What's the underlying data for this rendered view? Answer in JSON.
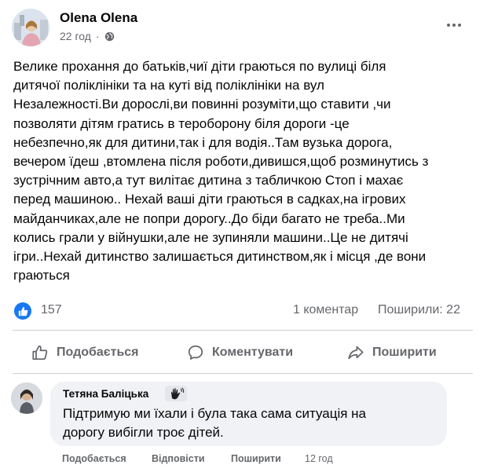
{
  "post": {
    "author": "Olena Olena",
    "time": "22 год",
    "privacy_icon": "globe-icon",
    "text_lines": [
      "Велике прохання до батьків,чиї діти граються по вулиці біля",
      "дитячої поліклініки та на куті від поліклініки на вул",
      "Незалежності.Ви дорослі,ви повинні розуміти,що ставити ,чи",
      "позволяти дітям гратись в тероборону біля дороги -це",
      "небезпечно,як для дитини,так і для водія..Там вузька дорога,",
      "вечером їдеш ,втомлена після роботи,дивишся,щоб розминутись з",
      "зустрічним авто,а тут вилітає дитина з табличкою Стоп і махає",
      "перед машиною.. Нехай ваші діти граються в садках,на ігрових",
      "майданчиках,але не попри дорогу..До біди багато не треба..Ми",
      "колись грали у війнушки,але не зупиняли машини..Це не дитячі",
      "ігри..Нехай дитинство залишається дитинством,як і місця ,де вони",
      "граються"
    ]
  },
  "stats": {
    "reactions": "157",
    "comments": "1 коментар",
    "shares": "Поширили: 22"
  },
  "actions": {
    "like": "Подобається",
    "comment": "Коментувати",
    "share": "Поширити"
  },
  "comment": {
    "author": "Тетяна Баліцька",
    "badge_icon": "waving-hand-icon",
    "text_lines": [
      "Підтримую ми їхали і була така сама ситуація на",
      "дорогу вибігли троє дітей."
    ],
    "like": "Подобається",
    "reply": "Відповісти",
    "share": "Поширити",
    "time": "12 год"
  },
  "colors": {
    "accent": "#1877f2",
    "secondary_text": "#65676b",
    "bubble": "#f0f2f5",
    "divider": "#ced0d4"
  }
}
